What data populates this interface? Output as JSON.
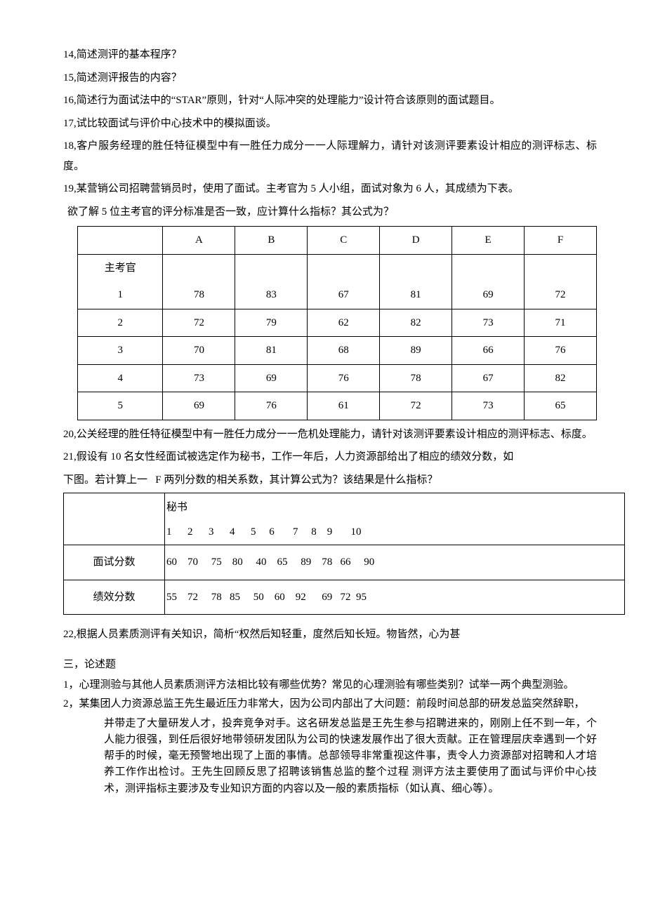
{
  "q14": "14,简述测评的基本程序？",
  "q15": "15,简述测评报告的内容？",
  "q16": "16,简述行为面试法中的“STAR”原则，针对“人际冲突的处理能力”设计符合该原则的面试题目。",
  "q17": "17,试比较面试与评价中心技术中的模拟面谈。",
  "q18": "18,客户服务经理的胜任特征模型中有一胜任力成分一一人际理解力，请针对该测评要素设计相应的测评标志、标度。",
  "q19": "19,某营销公司招聘营销员时，使用了面试。主考官为 5 人小组，面试对象为 6 人，其成绩为下表。",
  "q19a": "欲了解 5 位主考官的评分标准是否一致，应计算什么指标？其公式为？",
  "table1": {
    "cols": [
      "A",
      "B",
      "C",
      "D",
      "E",
      "F"
    ],
    "row_label": "主考官",
    "rows": [
      {
        "n": "1",
        "v": [
          "78",
          "83",
          "67",
          "81",
          "69",
          "72"
        ]
      },
      {
        "n": "2",
        "v": [
          "72",
          "79",
          "62",
          "82",
          "73",
          "71"
        ]
      },
      {
        "n": "3",
        "v": [
          "70",
          "81",
          "68",
          "89",
          "66",
          "76"
        ]
      },
      {
        "n": "4",
        "v": [
          "73",
          "69",
          "76",
          "78",
          "67",
          "82"
        ]
      },
      {
        "n": "5",
        "v": [
          "69",
          "76",
          "61",
          "72",
          "73",
          "65"
        ]
      }
    ]
  },
  "q20": "20,公关经理的胜任特征模型中有一胜任力成分一一危机处理能力，请针对该测评要素设计相应的测评标志、标度。",
  "q21a": "21,假设有 10 名女性经面试被选定作为秘书，工作一年后，人力资源部给出了相应的绩效分数，如",
  "q21b": "下图。若计算上一",
  "q21c": "F 两列分数的相关系数，其计算公式为？该结果是什么指标？",
  "table2": {
    "title": "秘书",
    "nums": "1      2      3      4      5     6       7     8    9       10",
    "r1_label": "面试分数",
    "r1": "60    70     75    80     40    65     89    78   66     90",
    "r2_label": "绩效分数",
    "r2": "55    72     78   85     50    60    92      69   72  95"
  },
  "q22": "22,根据人员素质测评有关知识，简析“权然后知轻重，度然后知长短。物皆然，心为甚",
  "section3": "三，论述题",
  "e1": "1，心理测验与其他人员素质测评方法相比较有哪些优势？常见的心理测验有哪些类别？试举一两个典型测验。",
  "e2a": "2，某集团人力资源总监王先生最近压力非常大，因为公司内部出了大问题：前段时间总部的研发总监突然辞职，",
  "e2b": "并带走了大量研发人才，投奔竞争对手。这名研发总监是王先生参与招聘进来的，刚刚上任不到一年，个人能力很强，到任后很好地带领研发团队为公司的快速发展作出了很大贡献。正在管理层庆幸遇到一个好帮手的时候，毫无预警地出现了上面的事情。总部领导非常重视这件事，责令人力资源部对招聘和人才培养工作作出检讨。王先生回顾反思了招聘该销售总监的整个过程  测评方法主要使用了面试与评价中心技术，测评指标主要涉及专业知识方面的内容以及一般的素质指标（如认真、细心等）。"
}
